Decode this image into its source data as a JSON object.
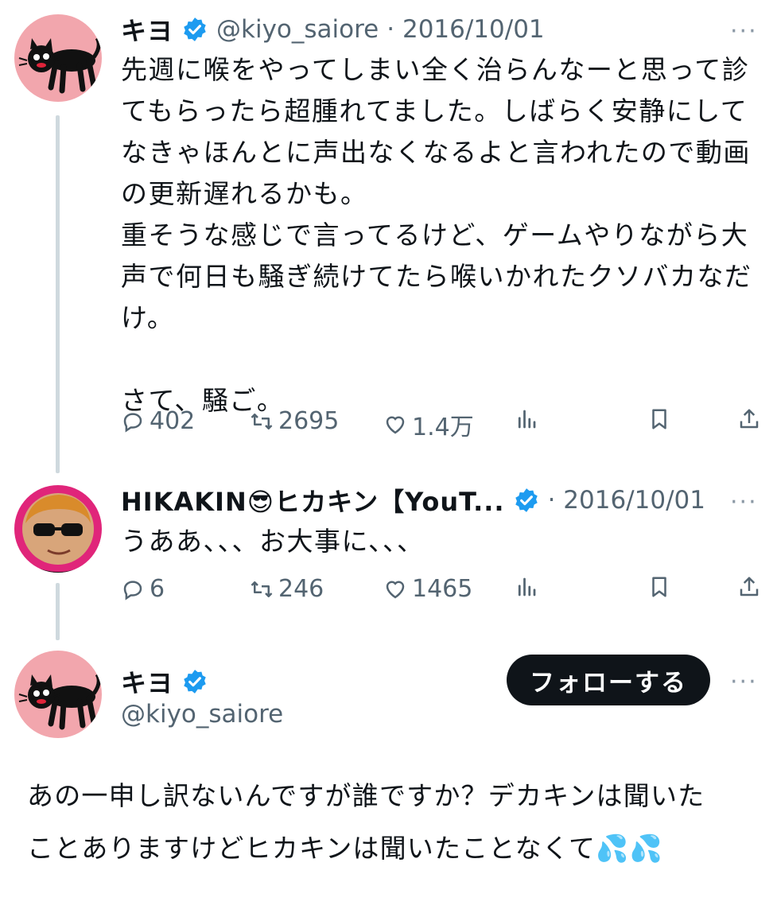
{
  "tweet1": {
    "name": "キヨ",
    "handle": "@kiyo_saiore",
    "date": "· 2016/10/01",
    "text": "先週に喉をやってしまい全く治らんなーと思って診\nてもらったら超腫れてました。しばらく安静にして\nなきゃほんとに声出なくなるよと言われたので動画\nの更新遅れるかも。\n重そうな感じで言ってるけど、ゲームやりながら大\n声で何日も騒ぎ続けてたら喉いかれたクソバカなだ\nけ。\n\nさて、騒ご。",
    "replies": "402",
    "retweets": "2695",
    "likes": "1.4万"
  },
  "tweet2": {
    "name": "HIKAKIN😎ヒカキン【YouT...",
    "date": "· 2016/10/01",
    "text": "うああ、、、お大事に、、、",
    "replies": "6",
    "retweets": "246",
    "likes": "1465"
  },
  "tweet3": {
    "name": "キヨ",
    "handle": "@kiyo_saiore",
    "follow_label": "フォローする",
    "text": "あの一申し訳ないんですが誰ですか？デカキンは聞いた\nことありますけどヒカキンは聞いたことなくて💦💦"
  },
  "more_icon": "···",
  "colors": {
    "verified": "#1d9bf0",
    "avatar_pink": "#f2a6ad",
    "avatar_magenta": "#e0257a"
  }
}
